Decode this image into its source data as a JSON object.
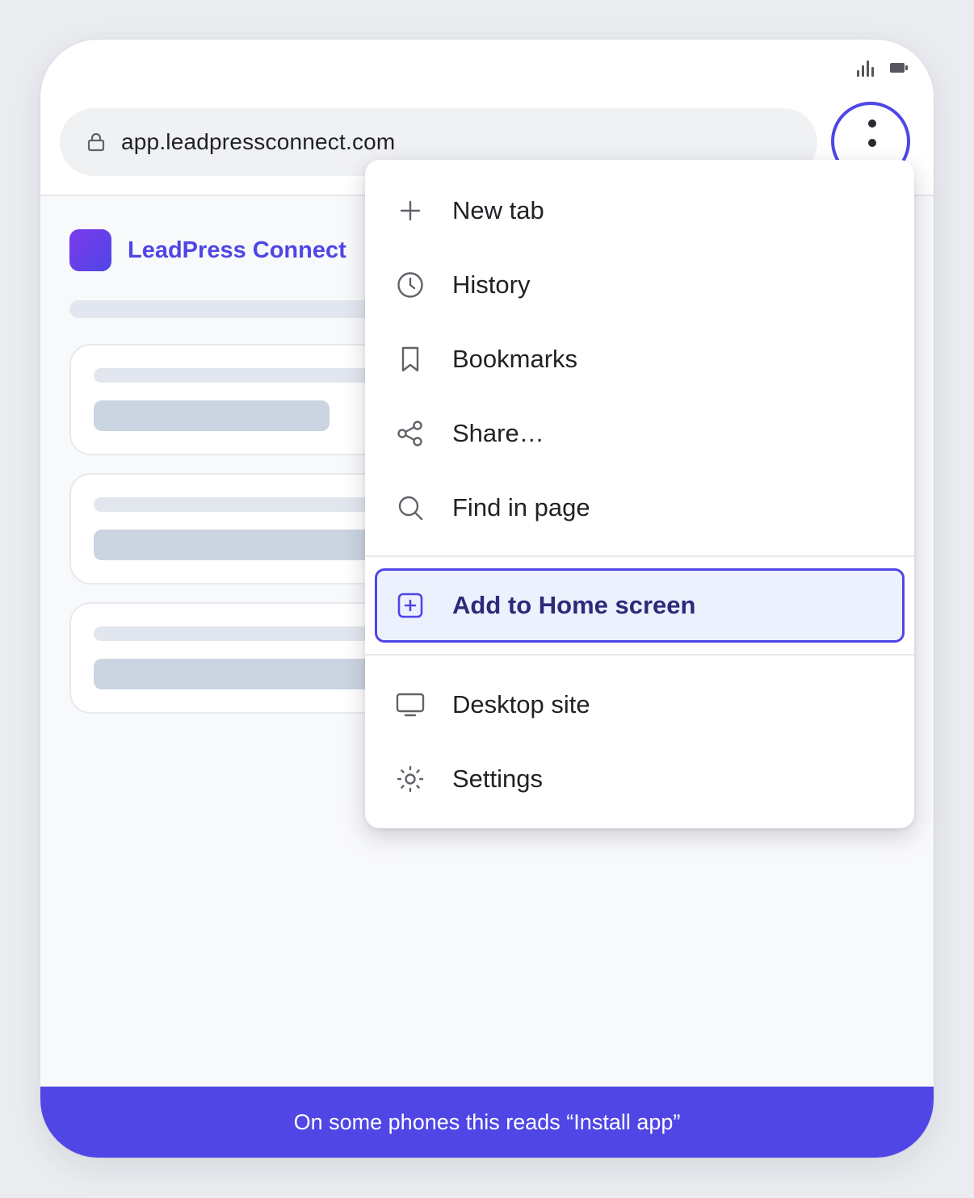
{
  "browser": {
    "url": "app.leadpressconnect.com"
  },
  "page": {
    "brand_name": "LeadPress Connect"
  },
  "menu": {
    "items": [
      {
        "label": "New tab",
        "icon": "plus-icon"
      },
      {
        "label": "History",
        "icon": "clock-icon"
      },
      {
        "label": "Bookmarks",
        "icon": "bookmark-icon"
      },
      {
        "label": "Share…",
        "icon": "share-icon"
      },
      {
        "label": "Find in page",
        "icon": "search-icon"
      }
    ],
    "highlighted": {
      "label": "Add to Home screen",
      "icon": "add-square-icon"
    },
    "bottom_items": [
      {
        "label": "Desktop site",
        "icon": "monitor-icon"
      },
      {
        "label": "Settings",
        "icon": "gear-icon"
      }
    ]
  },
  "banner": {
    "text": "On some phones this reads “Install app”"
  },
  "colors": {
    "accent": "#4f46e5",
    "highlight_bg": "#ecf1fd",
    "banner_bg": "#4f46e5"
  }
}
